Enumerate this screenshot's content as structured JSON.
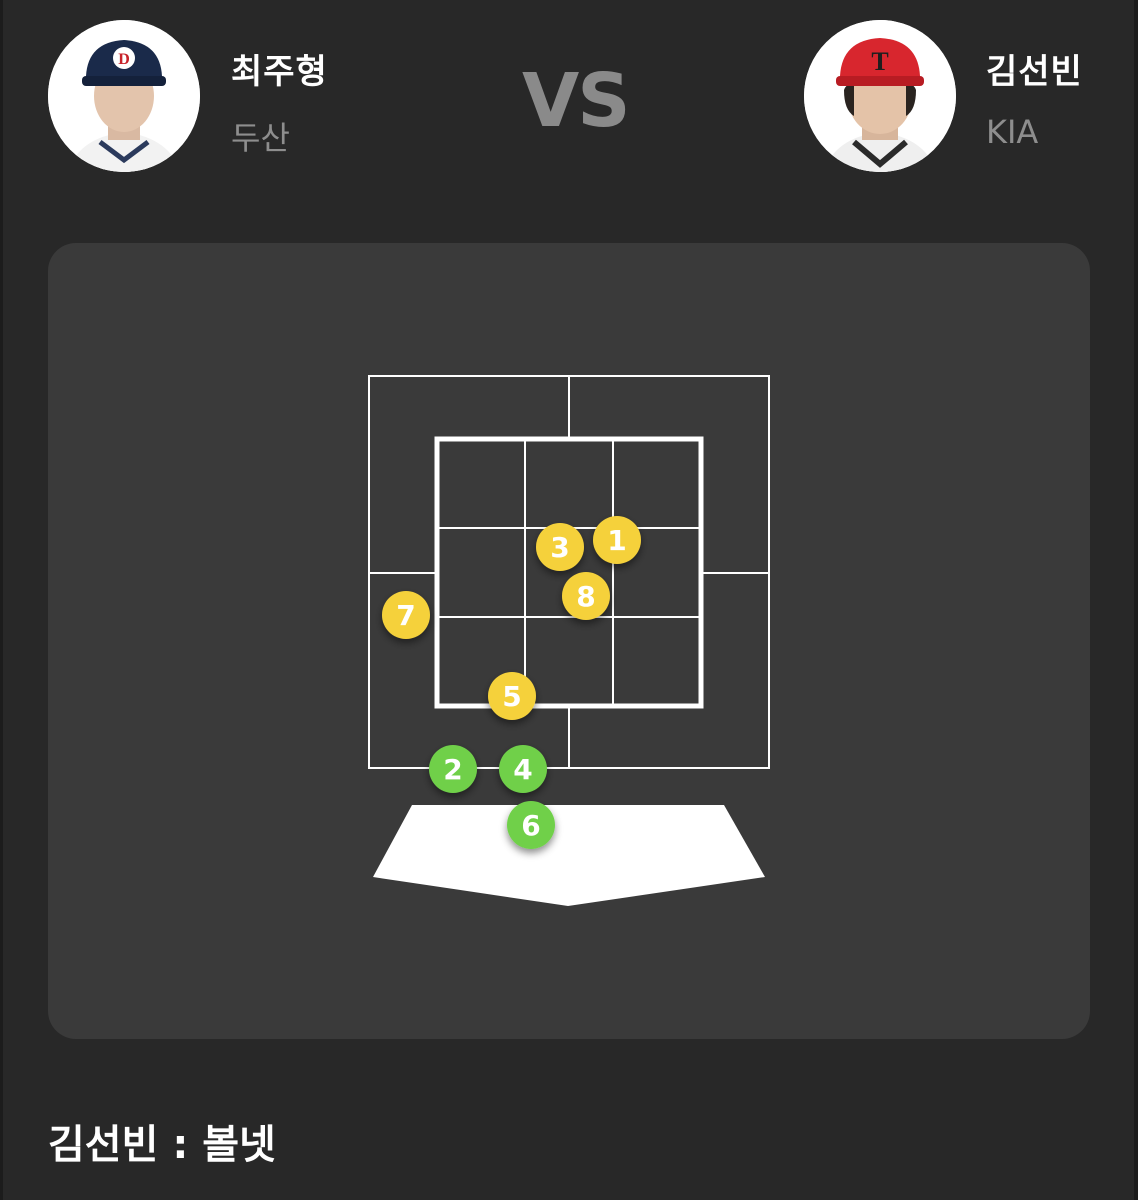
{
  "pitcher": {
    "name": "최주형",
    "team": "두산"
  },
  "vs_label": "VS",
  "batter": {
    "name": "김선빈",
    "team": "KIA"
  },
  "colors": {
    "background": "#282828",
    "panel": "#3a3a3a",
    "strike_pitch": "#f5d13b",
    "ball_pitch": "#6fd04a",
    "doosan_cap": "#1a2a4a",
    "kia_cap": "#d8262e"
  },
  "pitches": [
    {
      "number": "1",
      "type": "strike"
    },
    {
      "number": "2",
      "type": "ball"
    },
    {
      "number": "3",
      "type": "strike"
    },
    {
      "number": "4",
      "type": "ball"
    },
    {
      "number": "5",
      "type": "strike"
    },
    {
      "number": "6",
      "type": "ball"
    },
    {
      "number": "7",
      "type": "strike"
    },
    {
      "number": "8",
      "type": "strike"
    }
  ],
  "result": {
    "text": "김선빈 : 볼넷"
  }
}
